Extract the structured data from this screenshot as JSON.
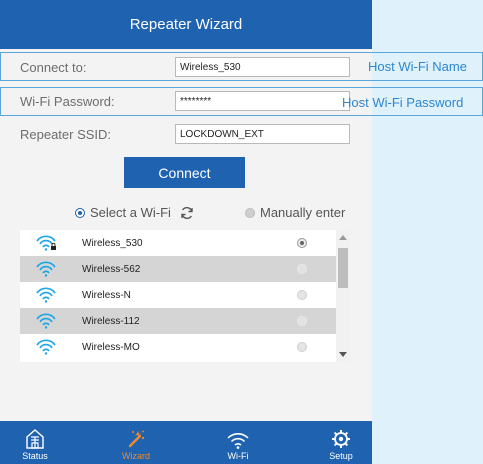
{
  "header": {
    "title": "Repeater Wizard"
  },
  "form": {
    "connect_to": {
      "label": "Connect to:",
      "value": "Wireless_530"
    },
    "password": {
      "label": "Wi-Fi Password:",
      "value": "********"
    },
    "ssid": {
      "label": "Repeater SSID:",
      "value": "LOCKDOWN_EXT"
    }
  },
  "callouts": {
    "host_name": "Host Wi-Fi Name",
    "host_password": "Host Wi-Fi Password"
  },
  "connect_button": "Connect",
  "mode": {
    "select_label": "Select a Wi-Fi",
    "manual_label": "Manually enter"
  },
  "networks": [
    {
      "name": "Wireless_530",
      "locked": true,
      "selected": true
    },
    {
      "name": "Wireless-562",
      "locked": false,
      "selected": false
    },
    {
      "name": "Wireless-N",
      "locked": false,
      "selected": false
    },
    {
      "name": "Wireless-112",
      "locked": false,
      "selected": false
    },
    {
      "name": "Wireless-MO",
      "locked": false,
      "selected": false
    }
  ],
  "nav": {
    "status": "Status",
    "wizard": "Wizard",
    "wifi": "Wi-Fi",
    "setup": "Setup"
  },
  "colors": {
    "primary": "#1f63b0",
    "accent": "#f08a2a",
    "callout": "#2d86d0",
    "wifi_icon": "#1aa7e8"
  }
}
